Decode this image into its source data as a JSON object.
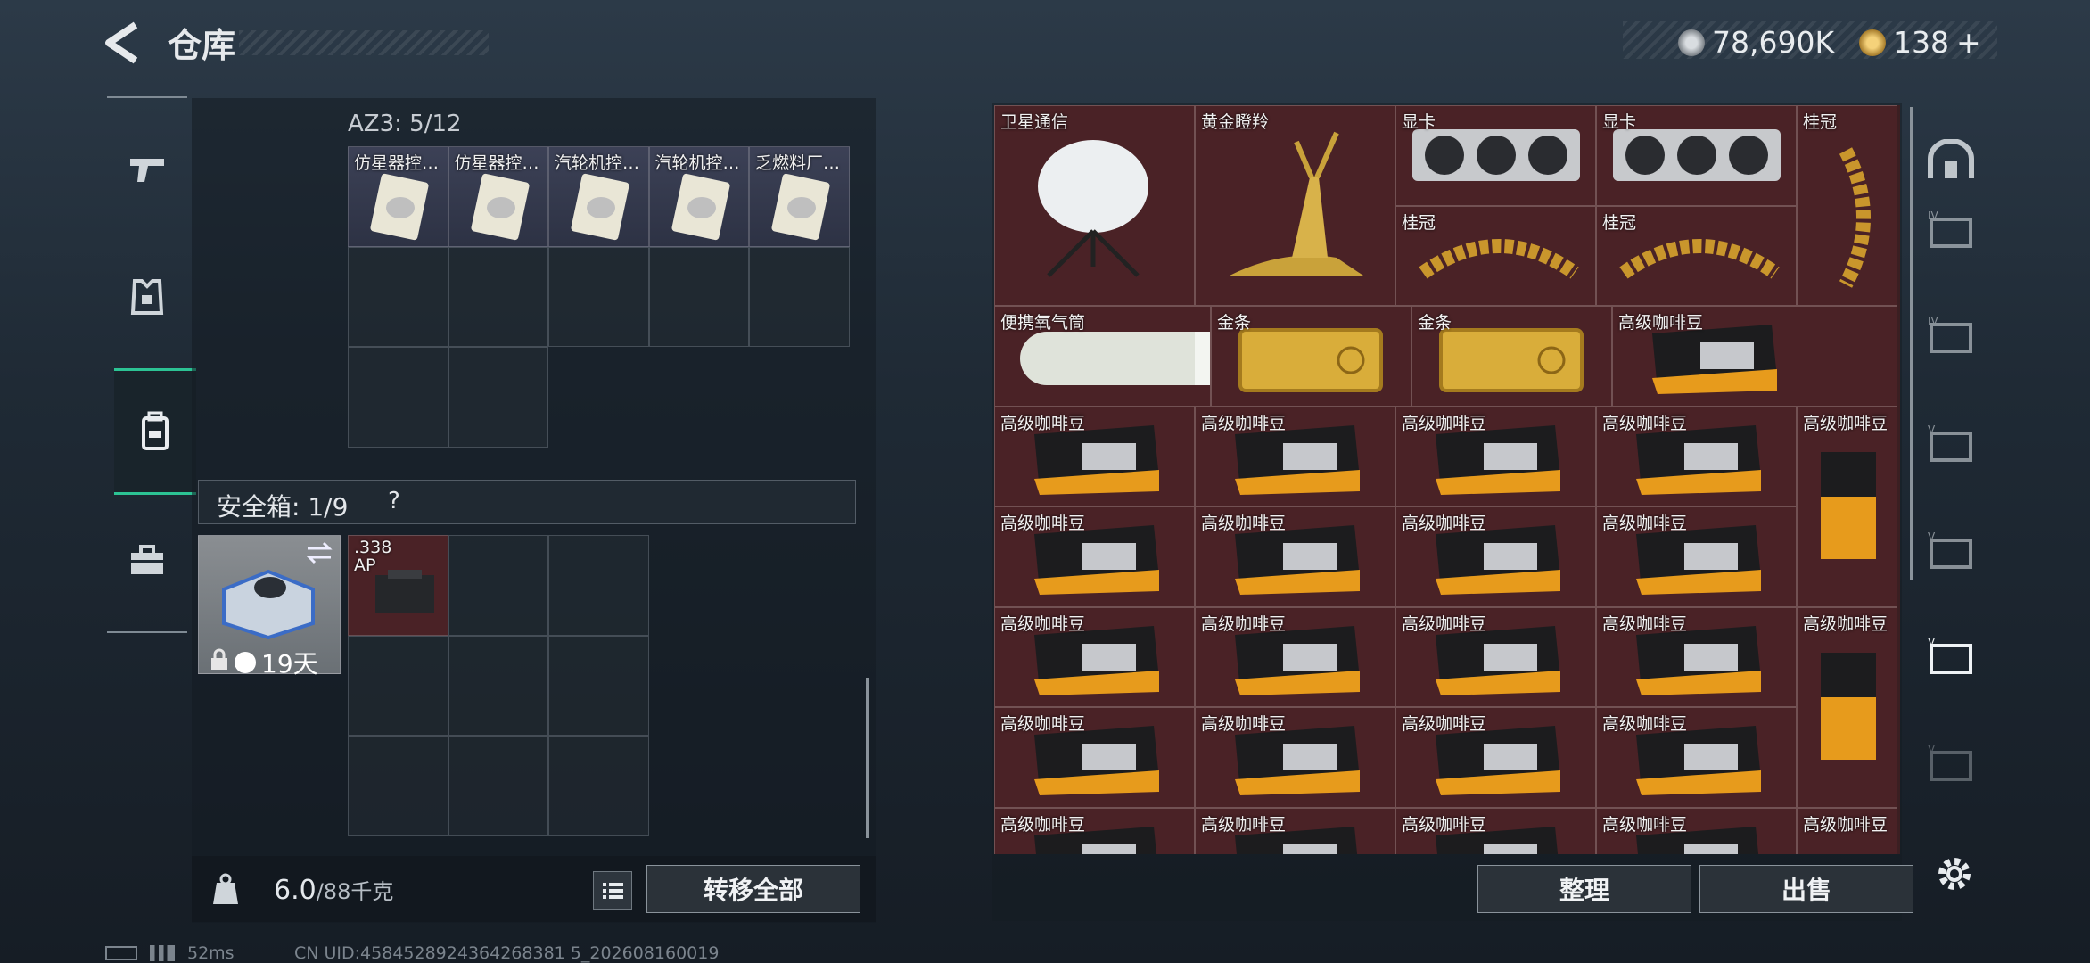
{
  "header": {
    "title": "仓库",
    "currency_a": "78,690K",
    "currency_b": "138",
    "currency_b_add": "+"
  },
  "sidenav": {
    "items": [
      {
        "icon": "gun-icon",
        "active": false
      },
      {
        "icon": "armor-icon",
        "active": false
      },
      {
        "icon": "backpack-icon",
        "active": true
      },
      {
        "icon": "briefcase-icon",
        "active": false
      }
    ]
  },
  "container": {
    "label": "AZ3: 5/12",
    "items": [
      {
        "name": "仿星器控…"
      },
      {
        "name": "仿星器控…"
      },
      {
        "name": "汽轮机控…"
      },
      {
        "name": "汽轮机控…"
      },
      {
        "name": "乏燃料厂…"
      }
    ]
  },
  "safe": {
    "label": "安全箱: 1/9",
    "help": "?",
    "days": "19天",
    "item_name": ".338 AP"
  },
  "bottom_left": {
    "weight_value": "6.0",
    "weight_max": "/88千克",
    "transfer_all": "转移全部"
  },
  "stash": {
    "items": [
      {
        "name": "卫星通信"
      },
      {
        "name": "黄金瞪羚"
      },
      {
        "name": "显卡"
      },
      {
        "name": "显卡"
      },
      {
        "name": "桂冠"
      },
      {
        "name": "桂冠"
      },
      {
        "name": "桂冠"
      },
      {
        "name": "便携氧气筒"
      },
      {
        "name": "金条"
      },
      {
        "name": "金条"
      },
      {
        "name": "高级咖啡豆"
      }
    ],
    "coffee_label": "高级咖啡豆"
  },
  "actions": {
    "sort": "整理",
    "sell": "出售"
  },
  "status": {
    "ping": "52ms",
    "uid": "CN UID:4584528924364268381 5_202608160019"
  },
  "colors": {
    "accent": "#2cc394",
    "item_bg": "#4a2226"
  }
}
